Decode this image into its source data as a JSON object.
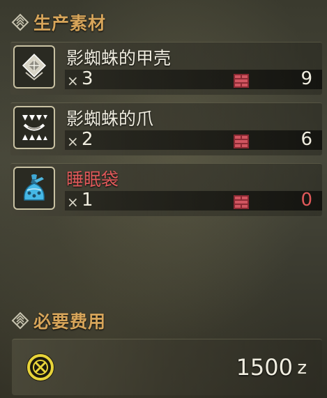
{
  "materials_section": {
    "title": "生产素材"
  },
  "materials": [
    {
      "name": "影蜘蛛的甲壳",
      "qty_prefix": "×",
      "required": "3",
      "owned": "9",
      "insufficient": false,
      "icon": "carapace-icon"
    },
    {
      "name": "影蜘蛛的爪",
      "qty_prefix": "×",
      "required": "2",
      "owned": "6",
      "insufficient": false,
      "icon": "claw-icon"
    },
    {
      "name": "睡眠袋",
      "qty_prefix": "×",
      "required": "1",
      "owned": "0",
      "insufficient": true,
      "icon": "sleep-sac-icon"
    }
  ],
  "cost_section": {
    "title": "必要费用",
    "amount": "1500",
    "currency": "z",
    "icon": "zenny-coin-icon"
  },
  "colors": {
    "section_title": "#d7a55a",
    "text": "#f0ede0",
    "insufficient": "#e0595a",
    "box_icon": "#c0404a"
  }
}
